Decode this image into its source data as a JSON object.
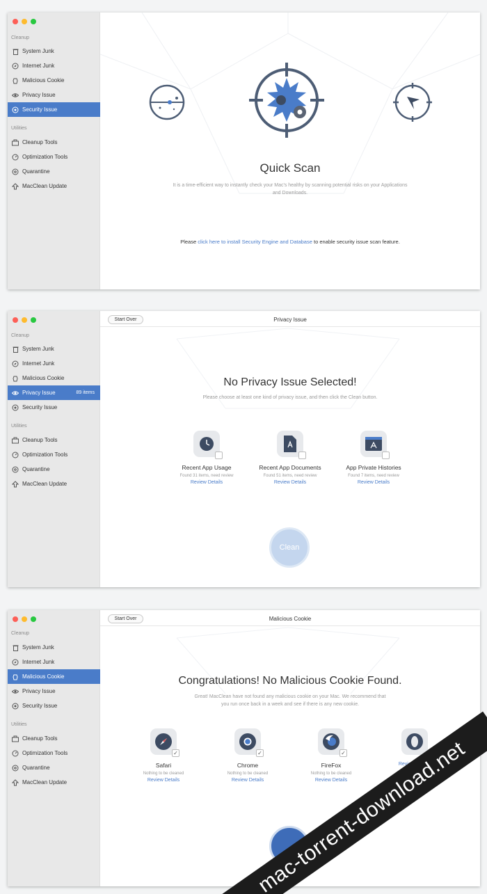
{
  "sidebar": {
    "cleanup_header": "Cleanup",
    "utilities_header": "Utilities",
    "items": [
      {
        "label": "System Junk",
        "icon": "trash-icon"
      },
      {
        "label": "Internet Junk",
        "icon": "compass-icon"
      },
      {
        "label": "Malicious Cookie",
        "icon": "cookie-icon"
      },
      {
        "label": "Privacy Issue",
        "icon": "eye-icon"
      },
      {
        "label": "Security Issue",
        "icon": "shield-icon"
      }
    ],
    "utilities": [
      {
        "label": "Cleanup Tools",
        "icon": "toolbox-icon"
      },
      {
        "label": "Optimization Tools",
        "icon": "gauge-icon"
      },
      {
        "label": "Quarantine",
        "icon": "biohazard-icon"
      },
      {
        "label": "MacClean Update",
        "icon": "upload-icon"
      }
    ],
    "privacy_count": "89 items"
  },
  "window1": {
    "selected": "Security Issue",
    "title": "Quick Scan",
    "description_line1": "It is a time-efficient way to instantly check your Mac's healthy by scanning potential risks on your Applications",
    "description_line2": "and Downloads.",
    "notice_prefix": "Please ",
    "notice_link": "click here to install Security Engine and Database",
    "notice_suffix": " to enable security issue scan feature."
  },
  "window2": {
    "selected": "Privacy Issue",
    "start_over": "Start Over",
    "title": "Privacy Issue",
    "heading": "No Privacy Issue Selected!",
    "subheading": "Please choose at least one kind of privacy issue, and then click the Clean button.",
    "cards": [
      {
        "name": "Recent App Usage",
        "sub": "Found 31 items, need review",
        "review": "Review Details",
        "icon": "clock-icon"
      },
      {
        "name": "Recent App Documents",
        "sub": "Found 51 items, need review",
        "review": "Review Details",
        "icon": "document-icon"
      },
      {
        "name": "App Private Histories",
        "sub": "Found 7 items, need review",
        "review": "Review Details",
        "icon": "app-store-icon"
      }
    ],
    "clean_label": "Clean"
  },
  "window3": {
    "selected": "Malicious Cookie",
    "start_over": "Start Over",
    "title": "Malicious Cookie",
    "heading": "Congratulations! No Malicious Cookie Found.",
    "subheading_line1": "Great! MacClean have not found any malicious cookie on your Mac. We recommend that",
    "subheading_line2": "you run once back in a week and see if there is any new cookie.",
    "cards": [
      {
        "name": "Safari",
        "sub": "Nothing to be cleaned",
        "review": "Review Details",
        "icon": "safari-icon"
      },
      {
        "name": "Chrome",
        "sub": "Nothing to be cleaned",
        "review": "Review Details",
        "icon": "chrome-icon"
      },
      {
        "name": "FireFox",
        "sub": "Nothing to be cleaned",
        "review": "Review Details",
        "icon": "firefox-icon"
      },
      {
        "name": "",
        "sub": "",
        "review": "Review Details",
        "icon": "opera-icon"
      }
    ]
  },
  "watermark": "mac-torrent-download.net",
  "colors": {
    "accent": "#4a7cc9",
    "icon_dark": "#4d5d75",
    "clean_button": "#c4d6ee"
  }
}
